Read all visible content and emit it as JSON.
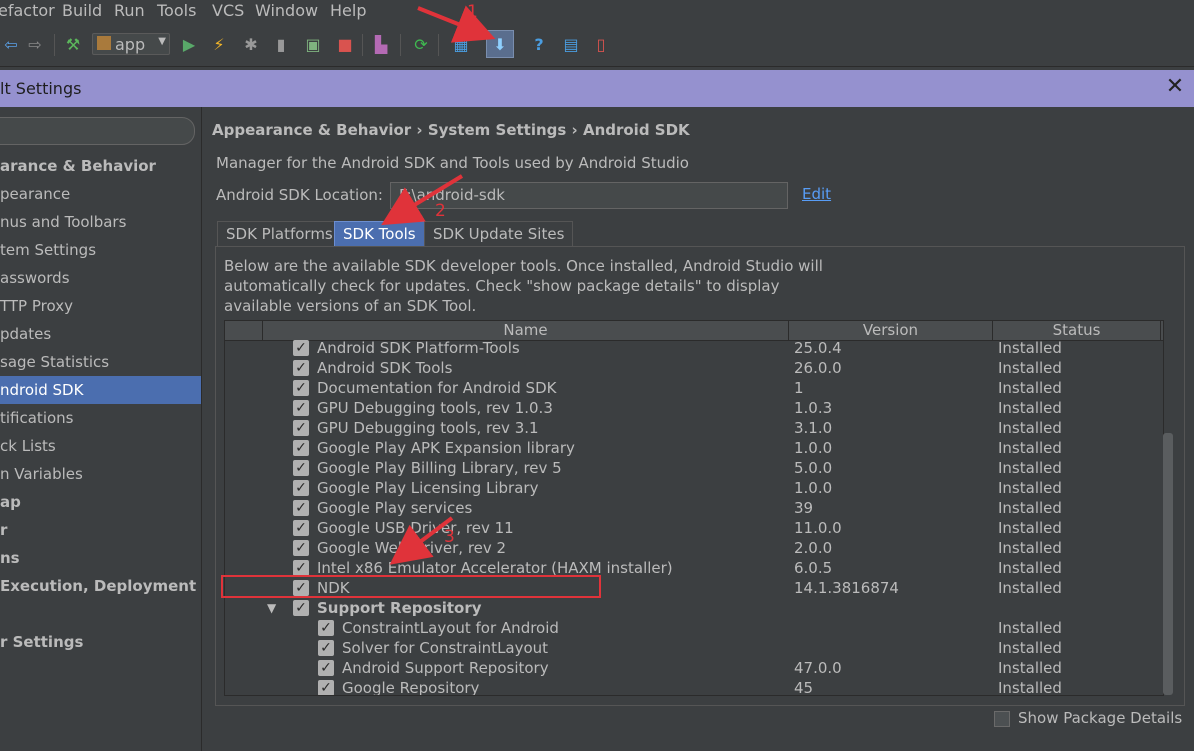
{
  "menubar": {
    "items": [
      "efactor",
      "Build",
      "Run",
      "Tools",
      "VCS",
      "Window",
      "Help"
    ]
  },
  "toolbar": {
    "run_config": "app",
    "icons": [
      "back-icon",
      "forward-icon",
      "build-hammer-icon",
      "run-icon",
      "apply-changes-icon",
      "debug-icon",
      "profile-icon",
      "attach-debugger-icon",
      "stop-icon",
      "avd-manager-icon",
      "sync-gradle-icon",
      "project-structure-icon",
      "sdk-manager-icon",
      "help-icon",
      "translate-icon",
      "device-icon"
    ]
  },
  "dialog": {
    "title": "lt Settings"
  },
  "sidebar": {
    "items": [
      {
        "label": "arance & Behavior",
        "bold": true,
        "selected": false
      },
      {
        "label": "pearance",
        "bold": false,
        "selected": false
      },
      {
        "label": "nus and Toolbars",
        "bold": false,
        "selected": false
      },
      {
        "label": "tem Settings",
        "bold": false,
        "selected": false
      },
      {
        "label": "asswords",
        "bold": false,
        "selected": false
      },
      {
        "label": "TTP Proxy",
        "bold": false,
        "selected": false
      },
      {
        "label": "pdates",
        "bold": false,
        "selected": false
      },
      {
        "label": "sage Statistics",
        "bold": false,
        "selected": false
      },
      {
        "label": "ndroid SDK",
        "bold": false,
        "selected": true
      },
      {
        "label": "tifications",
        "bold": false,
        "selected": false
      },
      {
        "label": "ck Lists",
        "bold": false,
        "selected": false
      },
      {
        "label": "n Variables",
        "bold": false,
        "selected": false
      },
      {
        "label": "ap",
        "bold": true,
        "selected": false
      },
      {
        "label": "r",
        "bold": true,
        "selected": false
      },
      {
        "label": "ns",
        "bold": true,
        "selected": false
      },
      {
        "label": " Execution, Deployment",
        "bold": true,
        "selected": false
      },
      {
        "label": "",
        "bold": true,
        "selected": false
      },
      {
        "label": "r Settings",
        "bold": true,
        "selected": false
      }
    ]
  },
  "main": {
    "breadcrumb": "Appearance & Behavior › System Settings › Android SDK",
    "description": "Manager for the Android SDK and Tools used by Android Studio",
    "location_label": "Android SDK Location:",
    "location_value": "F:\\android-sdk",
    "edit_link": "Edit",
    "tabs": [
      "SDK Platforms",
      "SDK Tools",
      "SDK Update Sites"
    ],
    "panel_desc": [
      "Below are the available SDK developer tools. Once installed, Android Studio will",
      "automatically check for updates. Check \"show package details\" to display",
      "available versions of an SDK Tool."
    ],
    "columns": [
      "Name",
      "Version",
      "Status"
    ],
    "rows": [
      {
        "name": "Android SDK Platform-Tools",
        "version": "25.0.4",
        "status": "Installed",
        "indent": 0
      },
      {
        "name": "Android SDK Tools",
        "version": "26.0.0",
        "status": "Installed",
        "indent": 0
      },
      {
        "name": "Documentation for Android SDK",
        "version": "1",
        "status": "Installed",
        "indent": 0
      },
      {
        "name": "GPU Debugging tools, rev 1.0.3",
        "version": "1.0.3",
        "status": "Installed",
        "indent": 0
      },
      {
        "name": "GPU Debugging tools, rev 3.1",
        "version": "3.1.0",
        "status": "Installed",
        "indent": 0
      },
      {
        "name": "Google Play APK Expansion library",
        "version": "1.0.0",
        "status": "Installed",
        "indent": 0
      },
      {
        "name": "Google Play Billing Library, rev 5",
        "version": "5.0.0",
        "status": "Installed",
        "indent": 0
      },
      {
        "name": "Google Play Licensing Library",
        "version": "1.0.0",
        "status": "Installed",
        "indent": 0
      },
      {
        "name": "Google Play services",
        "version": "39",
        "status": "Installed",
        "indent": 0
      },
      {
        "name": "Google USB Driver, rev 11",
        "version": "11.0.0",
        "status": "Installed",
        "indent": 0
      },
      {
        "name": "Google Web Driver, rev 2",
        "version": "2.0.0",
        "status": "Installed",
        "indent": 0
      },
      {
        "name": "Intel x86 Emulator Accelerator (HAXM installer)",
        "version": "6.0.5",
        "status": "Installed",
        "indent": 0
      },
      {
        "name": "NDK",
        "version": "14.1.3816874",
        "status": "Installed",
        "indent": 0
      },
      {
        "name": "Support Repository",
        "version": "",
        "status": "",
        "indent": 0,
        "group": true
      },
      {
        "name": "ConstraintLayout for Android",
        "version": "",
        "status": "Installed",
        "indent": 1
      },
      {
        "name": "Solver for ConstraintLayout",
        "version": "",
        "status": "Installed",
        "indent": 1
      },
      {
        "name": "Android Support Repository",
        "version": "47.0.0",
        "status": "Installed",
        "indent": 1
      },
      {
        "name": "Google Repository",
        "version": "45",
        "status": "Installed",
        "indent": 1
      }
    ],
    "show_package_details": "Show Package Details"
  },
  "annotations": {
    "n1": "1",
    "n2": "2",
    "n3": "3",
    "color": "#e0333a"
  }
}
